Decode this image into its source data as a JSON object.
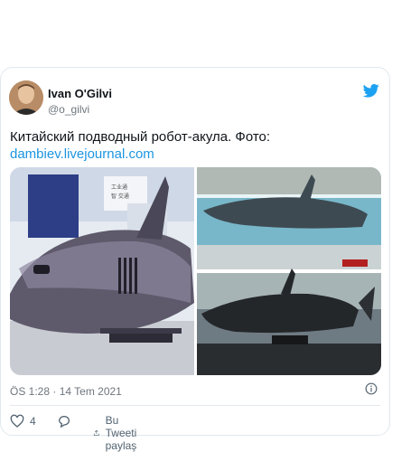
{
  "author": {
    "name": "Ivan O'Gilvi",
    "handle": "@o_gilvi"
  },
  "tweet": {
    "text": "Китайский подводный робот-акула. Фото:",
    "link": "dambiev.livejournal.com"
  },
  "meta": {
    "timestamp": "ÖS 1:28 · 14 Tem 2021"
  },
  "actions": {
    "like_count": "4",
    "share_label": "Bu Tweeti paylaş"
  },
  "colors": {
    "brand": "#1da1f2",
    "link": "#1b95e0",
    "muted": "#6e767d"
  },
  "icons": [
    "twitter-bird-icon",
    "info-icon",
    "heart-icon",
    "reply-icon",
    "share-icon"
  ]
}
